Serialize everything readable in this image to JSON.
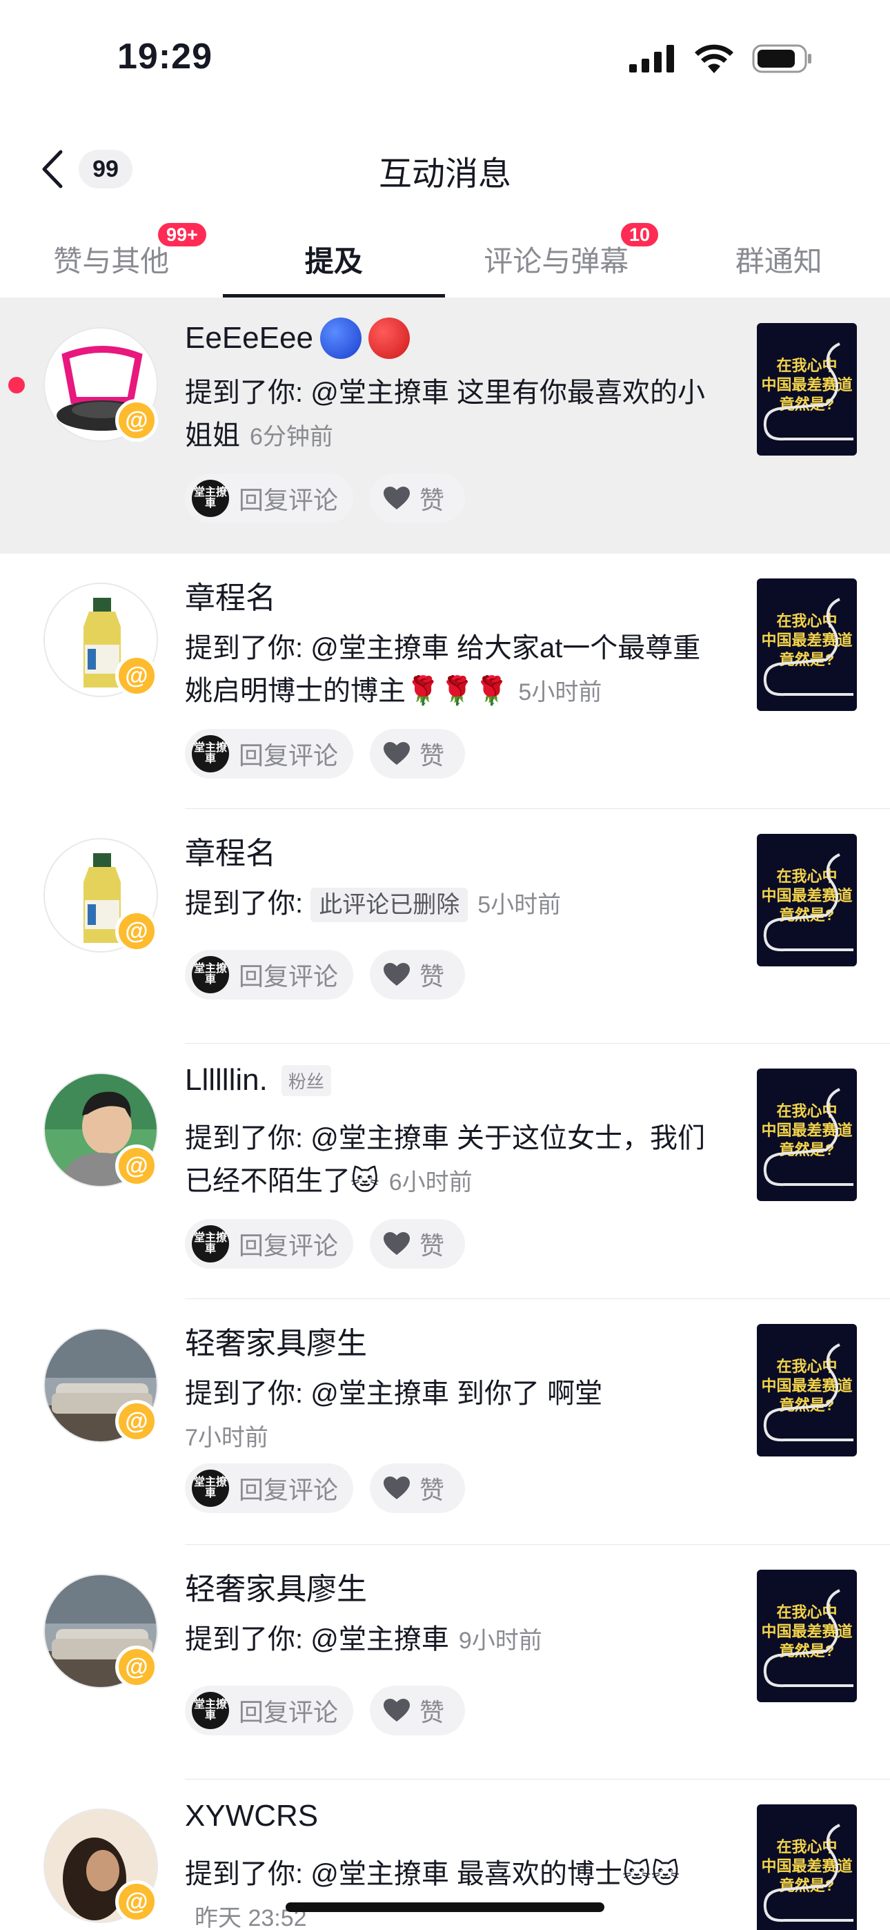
{
  "status": {
    "time": "19:29"
  },
  "nav": {
    "back_count": "99",
    "title": "互动消息"
  },
  "tabs": [
    {
      "label": "赞与其他",
      "badge": "99+"
    },
    {
      "label": "提及",
      "badge": ""
    },
    {
      "label": "评论与弹幕",
      "badge": "10"
    },
    {
      "label": "群通知",
      "badge": ""
    }
  ],
  "thumbnail_text": [
    "在我心中",
    "中国最差赛道",
    "竟然是?"
  ],
  "actions": {
    "reply_label": "回复评论",
    "like_label": "赞",
    "logo_text": "堂主撩車"
  },
  "items": [
    {
      "username": "EeEeEee",
      "prefix": "提到了你: ",
      "text": "@堂主撩車 这里有你最喜欢的小姐姐",
      "time": "6分钟前"
    },
    {
      "username": "章程名",
      "prefix": "提到了你: ",
      "text": "@堂主撩車 给大家at一个最尊重姚启明博士的博主🌹🌹🌹",
      "time": "5小时前"
    },
    {
      "username": "章程名",
      "prefix": "提到了你: ",
      "deleted": "此评论已删除",
      "time": "5小时前"
    },
    {
      "username": "Llllllin.",
      "tag": "粉丝",
      "prefix": "提到了你: ",
      "text": "@堂主撩車 关于这位女士，我们已经不陌生了🐱",
      "time": "6小时前"
    },
    {
      "username": "轻奢家具廖生",
      "prefix": "提到了你: ",
      "text": "@堂主撩車 到你了 啊堂",
      "time": "7小时前"
    },
    {
      "username": "轻奢家具廖生",
      "prefix": "提到了你: ",
      "text": "@堂主撩車",
      "time": "9小时前"
    },
    {
      "username": "XYWCRS",
      "prefix": "提到了你: ",
      "text": "@堂主撩車 最喜欢的博士🐱🐱",
      "time": "昨天 23:52"
    }
  ],
  "colors": {
    "accent": "#fe2c55",
    "at_badge": "#fdbb2d",
    "highlight_bg": "#efefef"
  }
}
